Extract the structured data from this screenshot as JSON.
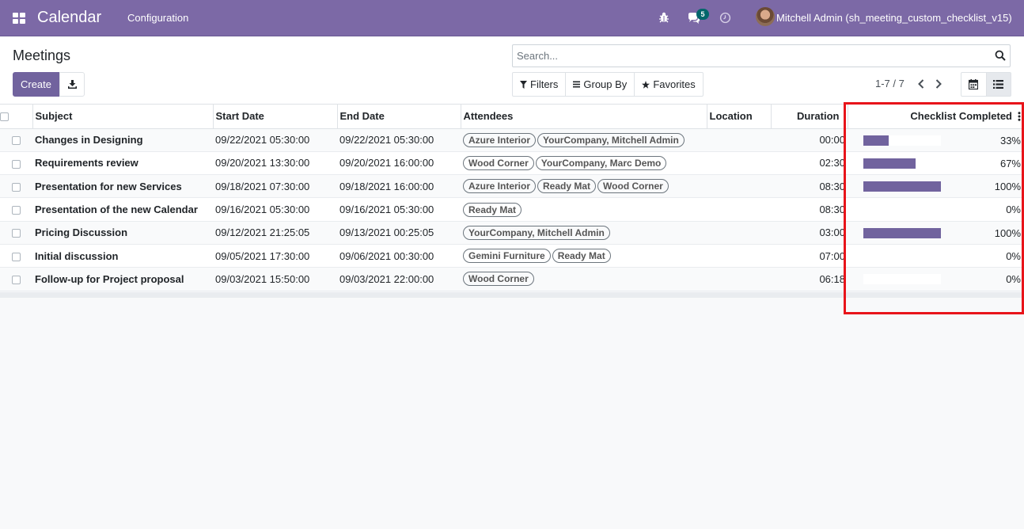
{
  "navbar": {
    "app_title": "Calendar",
    "menu_configuration": "Configuration",
    "messages_count": "5",
    "user_name": "Mitchell Admin (sh_meeting_custom_checklist_v15)",
    "color": "#7c69a6"
  },
  "control_panel": {
    "title": "Meetings",
    "create_label": "Create",
    "search_placeholder": "Search...",
    "filters_label": "Filters",
    "group_by_label": "Group By",
    "favorites_label": "Favorites",
    "pager_value": "1-7 / 7"
  },
  "table": {
    "headers": {
      "subject": "Subject",
      "start_date": "Start Date",
      "end_date": "End Date",
      "attendees": "Attendees",
      "location": "Location",
      "duration": "Duration",
      "checklist": "Checklist Completed"
    },
    "rows": [
      {
        "subject": "Changes in Designing",
        "start": "09/22/2021 05:30:00",
        "end": "09/22/2021 05:30:00",
        "attendees": [
          "Azure Interior",
          "YourCompany, Mitchell Admin"
        ],
        "location": "",
        "duration": "00:00",
        "progress": 33,
        "progress_label": "33%"
      },
      {
        "subject": "Requirements review",
        "start": "09/20/2021 13:30:00",
        "end": "09/20/2021 16:00:00",
        "attendees": [
          "Wood Corner",
          "YourCompany, Marc Demo"
        ],
        "location": "",
        "duration": "02:30",
        "progress": 67,
        "progress_label": "67%"
      },
      {
        "subject": "Presentation for new Services",
        "start": "09/18/2021 07:30:00",
        "end": "09/18/2021 16:00:00",
        "attendees": [
          "Azure Interior",
          "Ready Mat",
          "Wood Corner"
        ],
        "location": "",
        "duration": "08:30",
        "progress": 100,
        "progress_label": "100%"
      },
      {
        "subject": "Presentation of the new Calendar",
        "start": "09/16/2021 05:30:00",
        "end": "09/16/2021 05:30:00",
        "attendees": [
          "Ready Mat"
        ],
        "location": "",
        "duration": "08:30",
        "progress": 0,
        "progress_label": "0%"
      },
      {
        "subject": "Pricing Discussion",
        "start": "09/12/2021 21:25:05",
        "end": "09/13/2021 00:25:05",
        "attendees": [
          "YourCompany, Mitchell Admin"
        ],
        "location": "",
        "duration": "03:00",
        "progress": 100,
        "progress_label": "100%"
      },
      {
        "subject": "Initial discussion",
        "start": "09/05/2021 17:30:00",
        "end": "09/06/2021 00:30:00",
        "attendees": [
          "Gemini Furniture",
          "Ready Mat"
        ],
        "location": "",
        "duration": "07:00",
        "progress": 0,
        "progress_label": "0%"
      },
      {
        "subject": "Follow-up for Project proposal",
        "start": "09/03/2021 15:50:00",
        "end": "09/03/2021 22:00:00",
        "attendees": [
          "Wood Corner"
        ],
        "location": "",
        "duration": "06:18",
        "progress": 0,
        "progress_label": "0%"
      }
    ]
  },
  "colors": {
    "brand": "#7c69a6",
    "primary_button": "#71639e",
    "progress_fill": "#71639e",
    "highlight": "#e8141a"
  },
  "icons": {
    "apps": "apps-grid-icon",
    "bug": "bug-icon",
    "chat": "chat-icon",
    "clock": "clock-icon",
    "download": "download-icon",
    "search": "search-icon",
    "filter": "filter-icon",
    "group_by": "list-lines-icon",
    "favorites": "star-icon",
    "calendar_view": "calendar-icon",
    "list_view": "list-icon"
  }
}
